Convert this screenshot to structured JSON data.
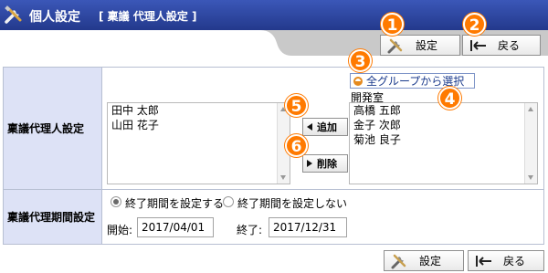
{
  "header": {
    "title": "個人設定",
    "subtitle": "[ 稟議 代理人設定 ]"
  },
  "toolbar": {
    "settings_label": "設定",
    "back_label": "戻る"
  },
  "markers": [
    "1",
    "2",
    "3",
    "4",
    "5",
    "6"
  ],
  "form": {
    "proxy": {
      "label": "稟議代理人設定",
      "selected_list": [
        "田中 太郎",
        "山田 花子"
      ],
      "add_label": "追加",
      "remove_label": "削除",
      "group_select_label": "全グループから選択",
      "group_name": "開発室",
      "candidates": [
        "高橋 五郎",
        "金子 次郎",
        "菊池 良子"
      ]
    },
    "period": {
      "label": "稟議代理期間設定",
      "option_set": "終了期間を設定する",
      "option_unset": "終了期間を設定しない",
      "selected": "option_set",
      "start_label": "開始:",
      "start_value": "2017/04/01",
      "end_label": "終了:",
      "end_value": "2017/12/31"
    }
  }
}
